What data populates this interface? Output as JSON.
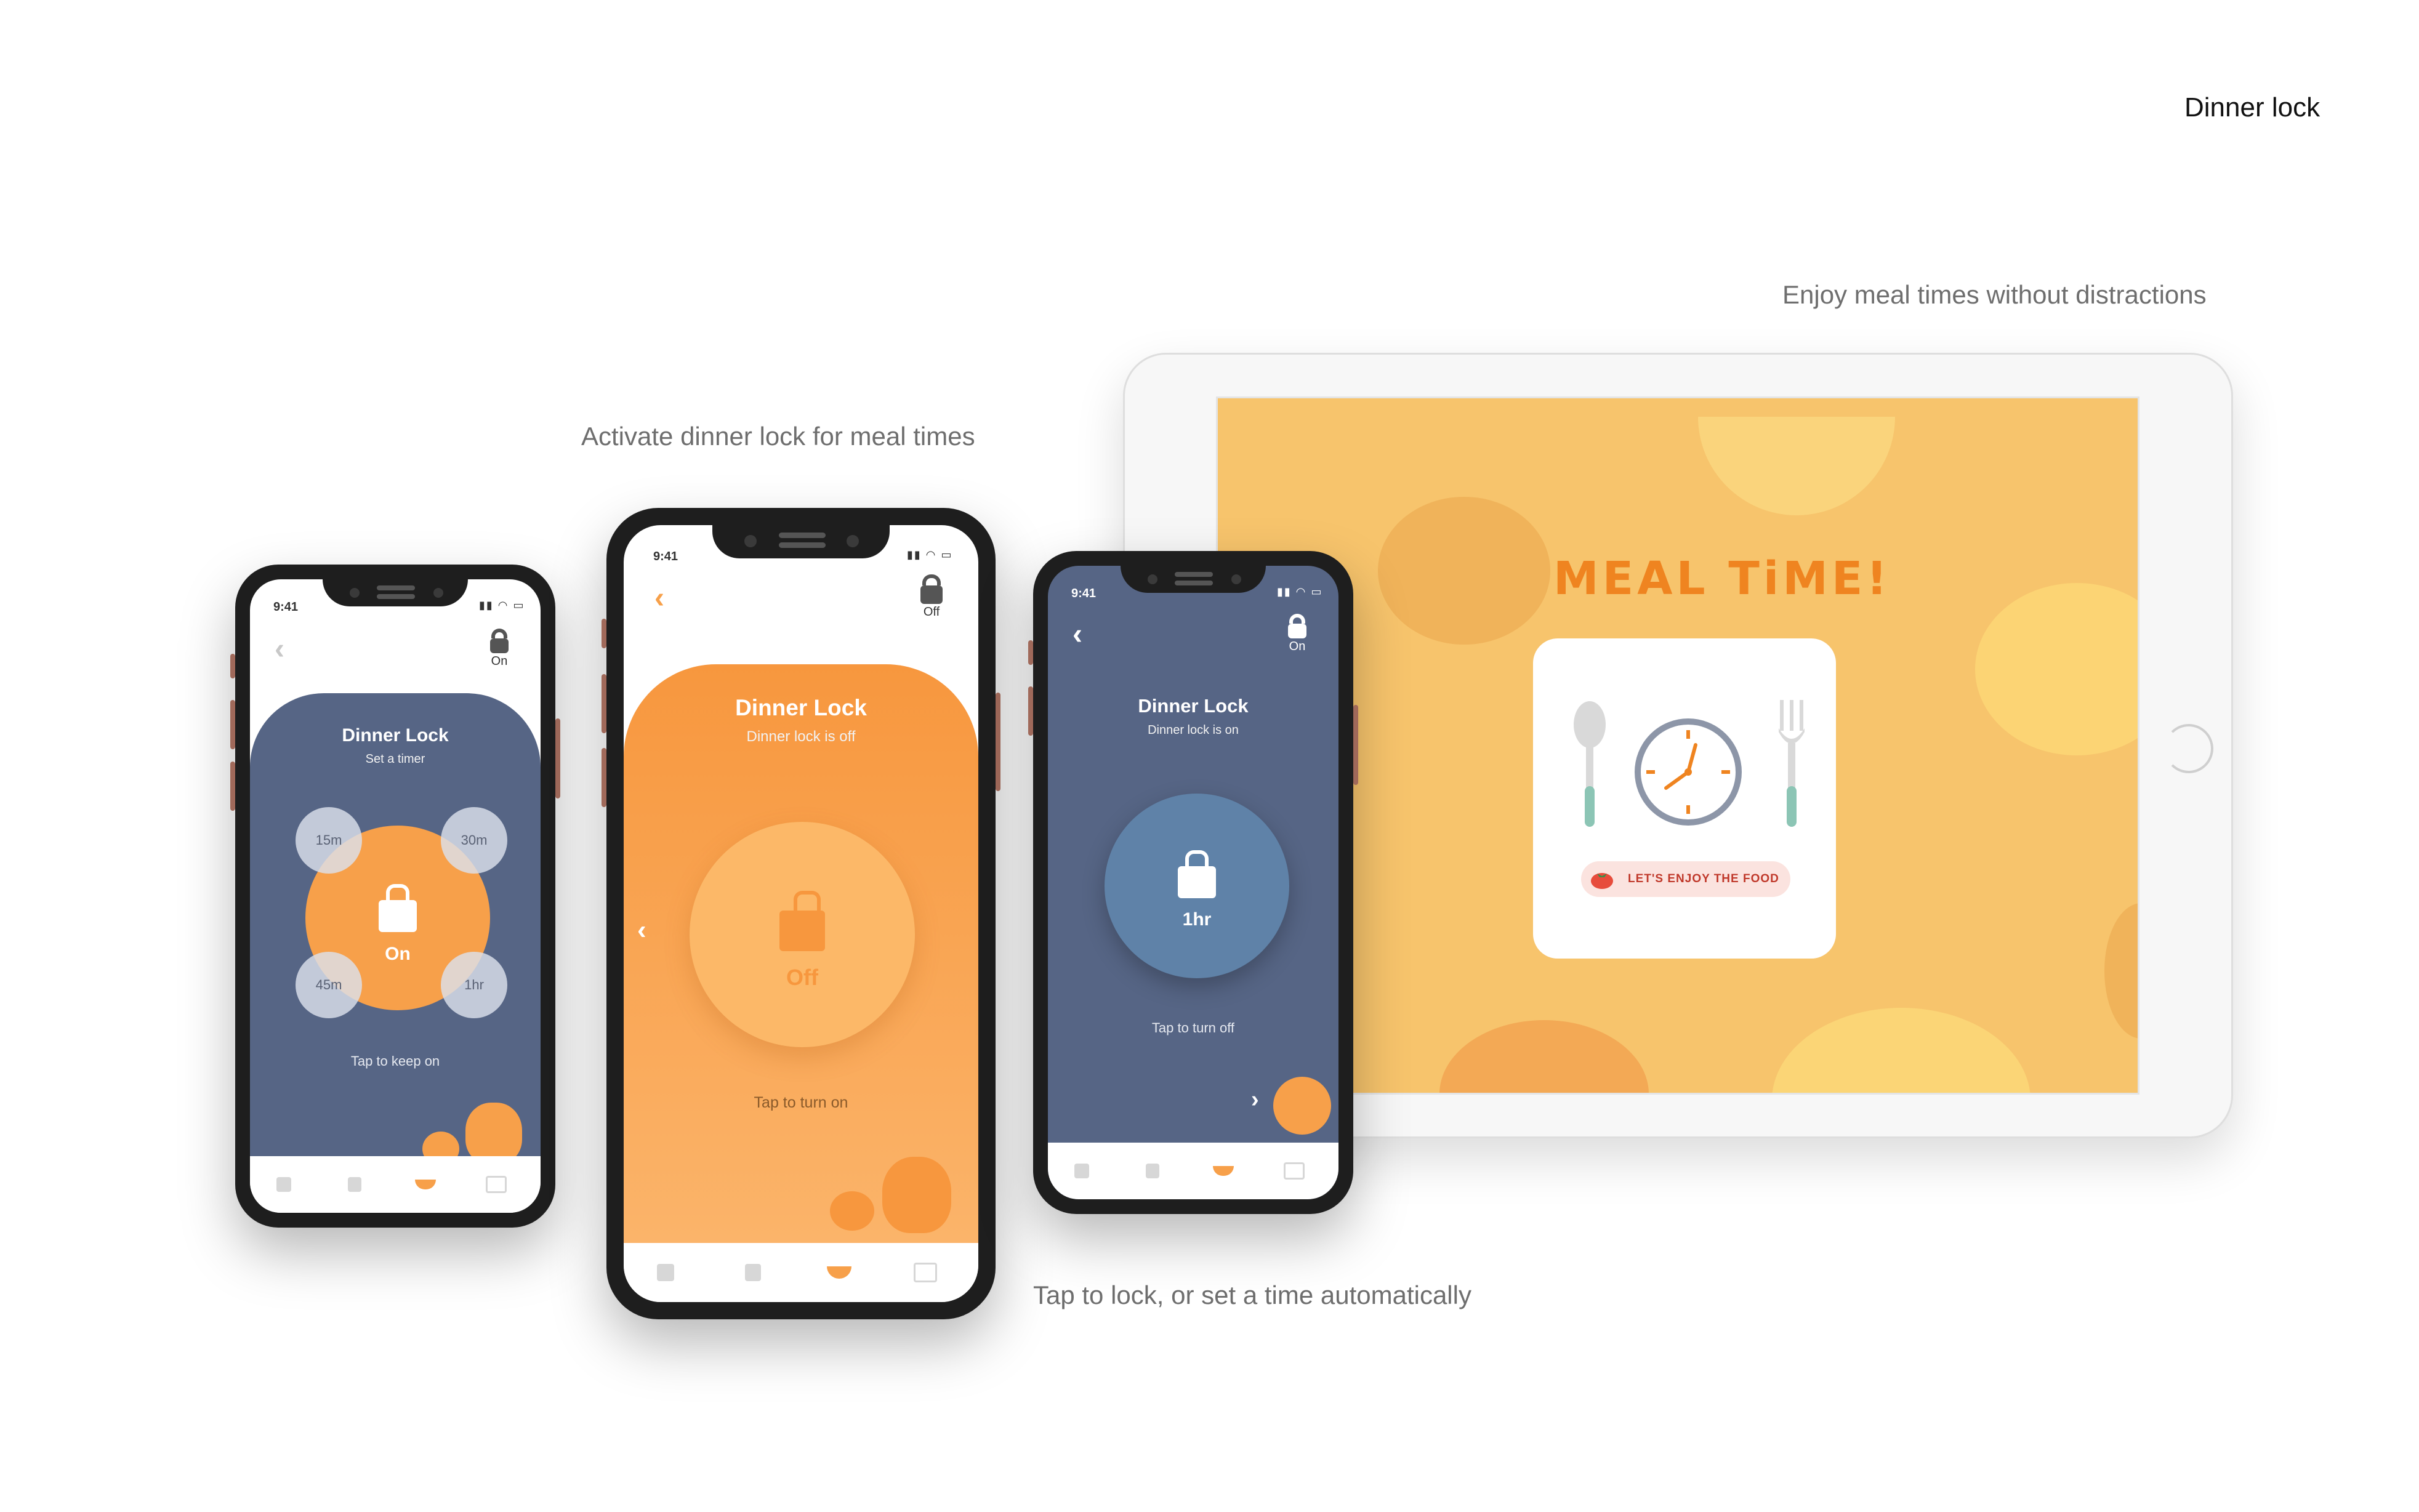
{
  "page": {
    "title": "Dinner lock"
  },
  "captions": {
    "tablet": "Enjoy meal times without distractions",
    "middle": "Activate dinner lock for meal times",
    "bottom": "Tap to lock, or set a time automatically"
  },
  "phones": [
    {
      "time": "9:41",
      "lock_status": "On",
      "title": "Dinner Lock",
      "subtitle": "Set a timer",
      "circle_label": "On",
      "timers": [
        "15m",
        "30m",
        "45m",
        "1hr"
      ],
      "tap_text": "Tap to keep on"
    },
    {
      "time": "9:41",
      "lock_status": "Off",
      "title": "Dinner Lock",
      "subtitle": "Dinner lock is off",
      "circle_label": "Off",
      "tap_text": "Tap to turn on"
    },
    {
      "time": "9:41",
      "lock_status": "On",
      "title": "Dinner Lock",
      "subtitle": "Dinner lock is on",
      "circle_label": "1hr",
      "tap_text": "Tap to turn off"
    }
  ],
  "tablet": {
    "headline": "MEAL TiME!",
    "pill_text": "LET'S ENJOY THE FOOD"
  },
  "colors": {
    "slate": "#566585",
    "orange": "#f7a04a",
    "light_orange": "#fbb868",
    "tablet_bg": "#f7c46c",
    "accent": "#ef8420"
  },
  "icons": [
    "back-chevron-icon",
    "lock-icon",
    "home-icon",
    "list-icon",
    "bowl-icon",
    "exit-icon",
    "clock-icon",
    "spoon-icon",
    "fork-icon",
    "tomato-icon"
  ]
}
